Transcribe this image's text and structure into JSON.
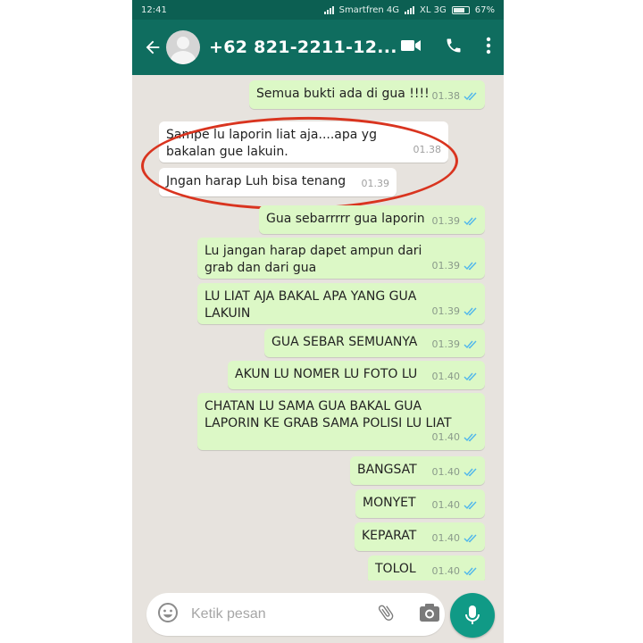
{
  "status_bar": {
    "time": "12:41",
    "carrier1": "Smartfren 4G",
    "carrier2": "XL 3G",
    "battery": "67%"
  },
  "header": {
    "contact": "+62 821-2211-12..."
  },
  "messages": [
    {
      "dir": "out",
      "text": "Semua bukti ada di gua !!!!",
      "time": "01.38"
    },
    {
      "dir": "in",
      "text": "Sampe lu laporin liat aja....apa yg bakalan gue lakuin.",
      "time": "01.38"
    },
    {
      "dir": "in",
      "text": "Jngan harap Luh bisa tenang",
      "time": "01.39"
    },
    {
      "dir": "out",
      "text": "Gua sebarrrrr gua laporin",
      "time": "01.39"
    },
    {
      "dir": "out",
      "text": "Lu jangan harap dapet ampun dari grab dan dari gua",
      "time": "01.39"
    },
    {
      "dir": "out",
      "text": "LU LIAT AJA BAKAL APA YANG GUA LAKUIN",
      "time": "01.39"
    },
    {
      "dir": "out",
      "text": "GUA SEBAR SEMUANYA",
      "time": "01.39"
    },
    {
      "dir": "out",
      "text": "AKUN LU NOMER LU FOTO LU",
      "time": "01.40"
    },
    {
      "dir": "out",
      "text": "CHATAN LU SAMA GUA BAKAL GUA LAPORIN KE GRAB SAMA POLISI LU LIAT",
      "time": "01.40"
    },
    {
      "dir": "out",
      "text": "BANGSAT",
      "time": "01.40"
    },
    {
      "dir": "out",
      "text": "MONYET",
      "time": "01.40"
    },
    {
      "dir": "out",
      "text": "KEPARAT",
      "time": "01.40"
    },
    {
      "dir": "out",
      "text": "TOLOL",
      "time": "01.40"
    }
  ],
  "input": {
    "placeholder": "Ketik pesan"
  },
  "icons": {
    "back": "arrow-left-icon",
    "video": "video-call-icon",
    "call": "phone-icon",
    "menu": "more-vert-icon",
    "emoji": "emoji-icon",
    "attach": "paperclip-icon",
    "camera": "camera-icon",
    "mic": "mic-icon"
  },
  "colors": {
    "header": "#0f6d5f",
    "outgoing_bubble": "#dcf8c6",
    "incoming_bubble": "#ffffff",
    "read_ticks": "#4fb6ec",
    "highlight": "#d9341f"
  }
}
